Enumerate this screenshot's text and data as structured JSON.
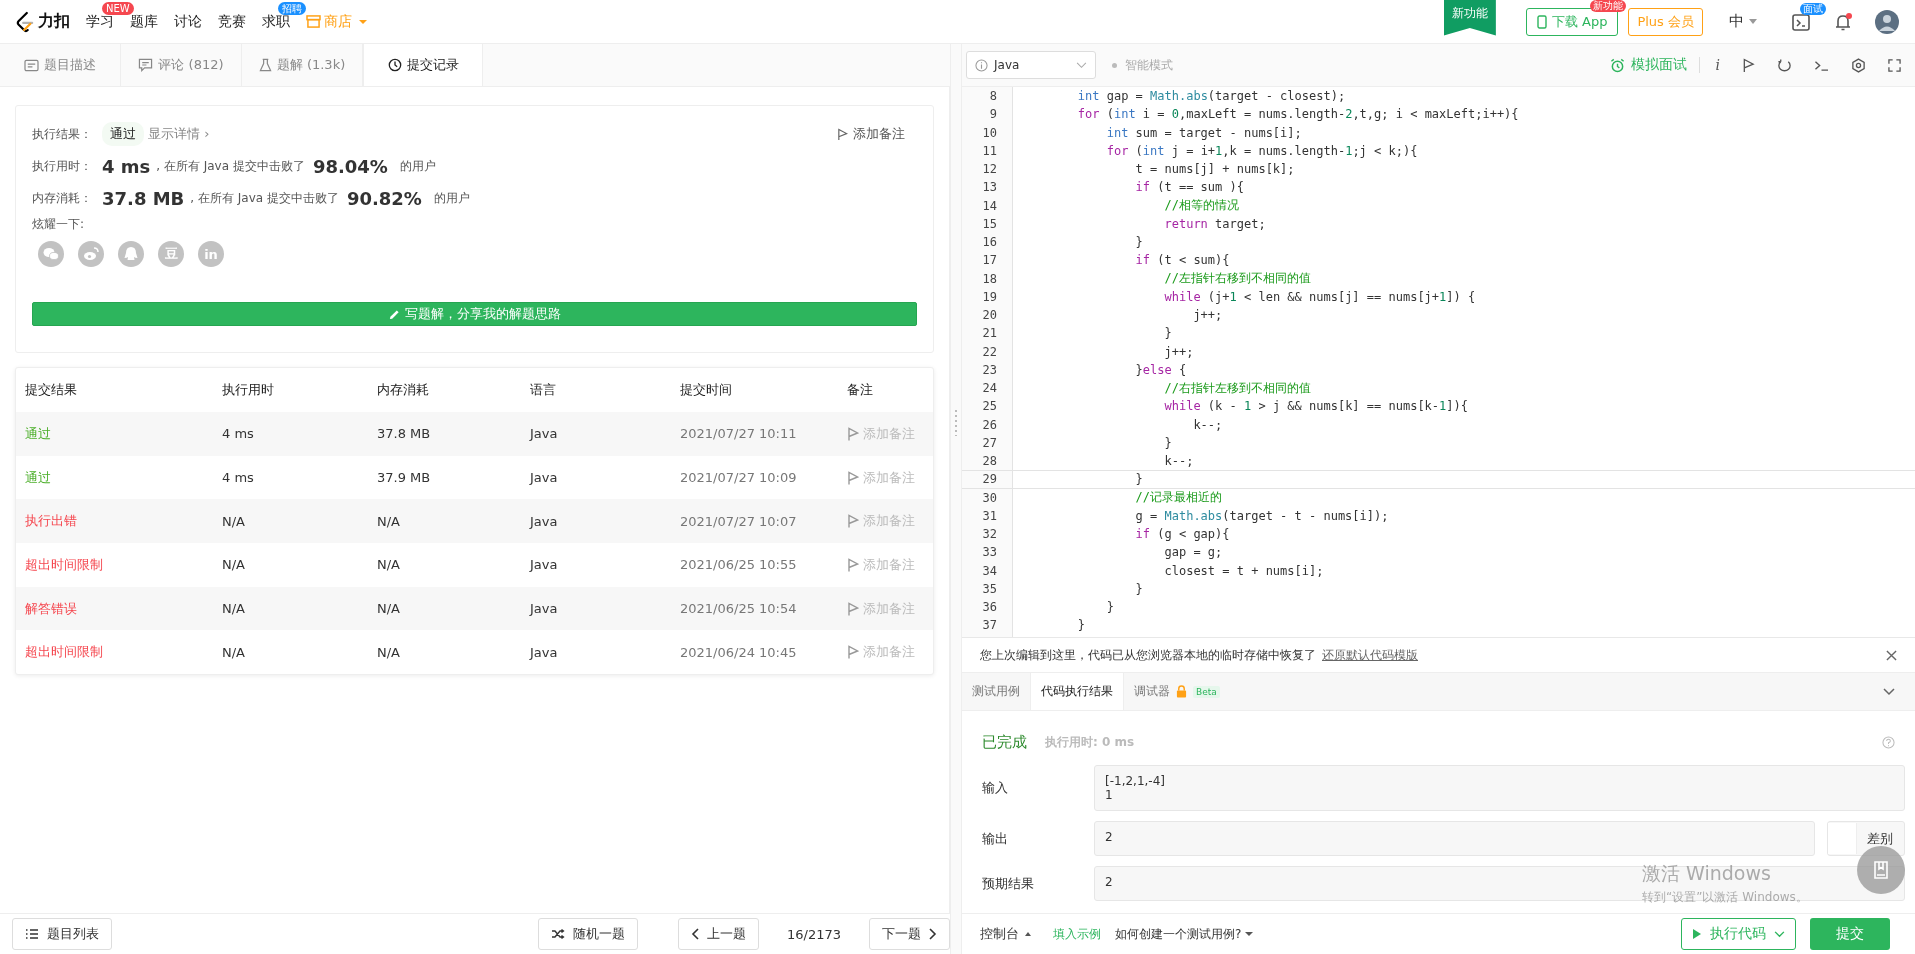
{
  "nav": {
    "logo_text": "力扣",
    "items": [
      {
        "label": "学习",
        "kind": "badge-red",
        "badge": "NEW"
      },
      {
        "label": "题库",
        "kind": "plain"
      },
      {
        "label": "讨论",
        "kind": "plain"
      },
      {
        "label": "竞赛",
        "kind": "plain"
      },
      {
        "label": "求职",
        "kind": "badge-blue",
        "badge": "招聘"
      },
      {
        "label": "商店",
        "kind": "store"
      }
    ],
    "feature_ribbon": "新功能",
    "download": {
      "label": "下载 App",
      "badge": "新功能"
    },
    "plus": "Plus 会员",
    "lang": "中",
    "interview_badge": "面试",
    "unread": true
  },
  "left_tabs": [
    {
      "label": "题目描述",
      "selected": false
    },
    {
      "label": "评论 (812)",
      "selected": false
    },
    {
      "label": "题解 (1.3k)",
      "selected": false
    },
    {
      "label": "提交记录",
      "selected": true
    }
  ],
  "result": {
    "label": "执行结果：",
    "status": "通过",
    "details": "显示详情 ›",
    "add_note": "添加备注",
    "stats": [
      {
        "label": "执行用时：",
        "value": "4 ms",
        "text": ", 在所有 Java 提交中击败了",
        "percent": "98.04%",
        "suffix": "的用户"
      },
      {
        "label": "内存消耗：",
        "value": "37.8 MB",
        "text": ", 在所有 Java 提交中击败了",
        "percent": "90.82%",
        "suffix": "的用户"
      }
    ],
    "share_label": "炫耀一下:",
    "share": [
      {
        "kind": "wechat"
      },
      {
        "kind": "weibo"
      },
      {
        "kind": "qq"
      },
      {
        "kind": "glyph",
        "text": "豆"
      },
      {
        "kind": "glyph",
        "text": "in"
      }
    ],
    "write_button": "写题解，分享我的解题思路"
  },
  "table": {
    "columns": [
      "提交结果",
      "执行用时",
      "内存消耗",
      "语言",
      "提交时间",
      "备注"
    ],
    "rows": [
      {
        "status": "通过",
        "kind": "pass",
        "time": "4 ms",
        "memory": "37.8 MB",
        "lang": "Java",
        "submitted": "2021/07/27 10:11",
        "note": "添加备注"
      },
      {
        "status": "通过",
        "kind": "pass",
        "time": "4 ms",
        "memory": "37.9 MB",
        "lang": "Java",
        "submitted": "2021/07/27 10:09",
        "note": "添加备注"
      },
      {
        "status": "执行出错",
        "kind": "fail",
        "time": "N/A",
        "memory": "N/A",
        "lang": "Java",
        "submitted": "2021/07/27 10:07",
        "note": "添加备注"
      },
      {
        "status": "超出时间限制",
        "kind": "fail",
        "time": "N/A",
        "memory": "N/A",
        "lang": "Java",
        "submitted": "2021/06/25 10:55",
        "note": "添加备注"
      },
      {
        "status": "解答错误",
        "kind": "fail",
        "time": "N/A",
        "memory": "N/A",
        "lang": "Java",
        "submitted": "2021/06/25 10:54",
        "note": "添加备注"
      },
      {
        "status": "超出时间限制",
        "kind": "fail",
        "time": "N/A",
        "memory": "N/A",
        "lang": "Java",
        "submitted": "2021/06/24 10:45",
        "note": "添加备注"
      }
    ]
  },
  "bottom_left": {
    "list_button": "题目列表",
    "random": "随机一题",
    "prev": "上一题",
    "page": "16/2173",
    "next": "下一题"
  },
  "editor": {
    "language": "Java",
    "smart_mode": "智能模式",
    "mock_interview": "模拟面试",
    "info_glyph": "i",
    "lines": [
      {
        "num": "8",
        "current": false,
        "segs": [
          {
            "text": "        int",
            "kind": "type"
          },
          {
            "text": " gap = "
          },
          {
            "text": "Math.abs",
            "kind": "call"
          },
          {
            "text": "(target - closest);"
          }
        ]
      },
      {
        "num": "9",
        "current": false,
        "segs": [
          {
            "text": "        for",
            "kind": "keyword"
          },
          {
            "text": " ("
          },
          {
            "text": "int",
            "kind": "type"
          },
          {
            "text": " i = "
          },
          {
            "text": "0",
            "kind": "number"
          },
          {
            "text": ",maxLeft = nums.length-"
          },
          {
            "text": "2",
            "kind": "number"
          },
          {
            "text": ",t,g; i < maxLeft;i++){"
          }
        ]
      },
      {
        "num": "10",
        "current": false,
        "segs": [
          {
            "text": "            int",
            "kind": "type"
          },
          {
            "text": " sum = target - nums[i];"
          }
        ]
      },
      {
        "num": "11",
        "current": false,
        "segs": [
          {
            "text": "            for",
            "kind": "keyword"
          },
          {
            "text": " ("
          },
          {
            "text": "int",
            "kind": "type"
          },
          {
            "text": " j = i+"
          },
          {
            "text": "1",
            "kind": "number"
          },
          {
            "text": ",k = nums.length-"
          },
          {
            "text": "1",
            "kind": "number"
          },
          {
            "text": ";j < k;){"
          }
        ]
      },
      {
        "num": "12",
        "current": false,
        "segs": [
          {
            "text": "                t = nums[j] + nums[k];"
          }
        ]
      },
      {
        "num": "13",
        "current": false,
        "segs": [
          {
            "text": "                if",
            "kind": "keyword"
          },
          {
            "text": " (t == sum ){"
          }
        ]
      },
      {
        "num": "14",
        "current": false,
        "segs": [
          {
            "text": "                    //相等的情况",
            "kind": "comment"
          }
        ]
      },
      {
        "num": "15",
        "current": false,
        "segs": [
          {
            "text": "                    return",
            "kind": "keyword"
          },
          {
            "text": " target;"
          }
        ]
      },
      {
        "num": "16",
        "current": false,
        "segs": [
          {
            "text": "                }"
          }
        ]
      },
      {
        "num": "17",
        "current": false,
        "segs": [
          {
            "text": "                if",
            "kind": "keyword"
          },
          {
            "text": " (t < sum){"
          }
        ]
      },
      {
        "num": "18",
        "current": false,
        "segs": [
          {
            "text": "                    //左指针右移到不相同的值",
            "kind": "comment"
          }
        ]
      },
      {
        "num": "19",
        "current": false,
        "segs": [
          {
            "text": "                    while",
            "kind": "keyword"
          },
          {
            "text": " (j+"
          },
          {
            "text": "1",
            "kind": "number"
          },
          {
            "text": " < len && nums[j] == nums[j+"
          },
          {
            "text": "1",
            "kind": "number"
          },
          {
            "text": "]) {"
          }
        ]
      },
      {
        "num": "20",
        "current": false,
        "segs": [
          {
            "text": "                        j++;"
          }
        ]
      },
      {
        "num": "21",
        "current": false,
        "segs": [
          {
            "text": "                    }"
          }
        ]
      },
      {
        "num": "22",
        "current": false,
        "segs": [
          {
            "text": "                    j++;"
          }
        ]
      },
      {
        "num": "23",
        "current": false,
        "segs": [
          {
            "text": "                }"
          },
          {
            "text": "else",
            "kind": "keyword"
          },
          {
            "text": " {"
          }
        ]
      },
      {
        "num": "24",
        "current": false,
        "segs": [
          {
            "text": "                    //右指针左移到不相同的值",
            "kind": "comment"
          }
        ]
      },
      {
        "num": "25",
        "current": false,
        "segs": [
          {
            "text": "                    while",
            "kind": "keyword"
          },
          {
            "text": " (k - "
          },
          {
            "text": "1",
            "kind": "number"
          },
          {
            "text": " > j && nums[k] == nums[k-"
          },
          {
            "text": "1",
            "kind": "number"
          },
          {
            "text": "]){"
          }
        ]
      },
      {
        "num": "26",
        "current": false,
        "segs": [
          {
            "text": "                        k--;"
          }
        ]
      },
      {
        "num": "27",
        "current": false,
        "segs": [
          {
            "text": "                    }"
          }
        ]
      },
      {
        "num": "28",
        "current": false,
        "segs": [
          {
            "text": "                    k--;"
          }
        ]
      },
      {
        "num": "29",
        "current": true,
        "segs": [
          {
            "text": "                }"
          }
        ]
      },
      {
        "num": "30",
        "current": false,
        "segs": [
          {
            "text": "                //记录最相近的",
            "kind": "comment"
          }
        ]
      },
      {
        "num": "31",
        "current": false,
        "segs": [
          {
            "text": "                g = "
          },
          {
            "text": "Math.abs",
            "kind": "call"
          },
          {
            "text": "(target - t - nums[i]);"
          }
        ]
      },
      {
        "num": "32",
        "current": false,
        "segs": [
          {
            "text": "                if",
            "kind": "keyword"
          },
          {
            "text": " (g < gap){"
          }
        ]
      },
      {
        "num": "33",
        "current": false,
        "segs": [
          {
            "text": "                    gap = g;"
          }
        ]
      },
      {
        "num": "34",
        "current": false,
        "segs": [
          {
            "text": "                    closest = t + nums[i];"
          }
        ]
      },
      {
        "num": "35",
        "current": false,
        "segs": [
          {
            "text": "                }"
          }
        ]
      },
      {
        "num": "36",
        "current": false,
        "segs": [
          {
            "text": "            }"
          }
        ]
      },
      {
        "num": "37",
        "current": false,
        "segs": [
          {
            "text": "        }"
          }
        ]
      }
    ]
  },
  "notice": {
    "text": "您上次编辑到这里，代码已从您浏览器本地的临时存储中恢复了",
    "link": "还原默认代码模版"
  },
  "console_tabs": [
    {
      "label": "测试用例",
      "selected": false
    },
    {
      "label": "代码执行结果",
      "selected": true
    },
    {
      "label": "调试器",
      "selected": false,
      "locked": true,
      "badge": "Beta"
    }
  ],
  "run_result": {
    "status": "已完成",
    "time": "执行用时: 0 ms",
    "fields": [
      {
        "label": "输入",
        "lines": [
          "[-1,2,1,-4]",
          "1"
        ]
      },
      {
        "label": "输出",
        "lines": [
          "2"
        ],
        "diff": "差别"
      },
      {
        "label": "预期结果",
        "lines": [
          "2"
        ]
      }
    ]
  },
  "bottom_right": {
    "console": "控制台",
    "fill_example": "填入示例",
    "howto": "如何创建一个测试用例?",
    "run": "执行代码",
    "submit": "提交"
  },
  "os_overlay": {
    "title": "激活 Windows",
    "subtitle": "转到“设置”以激活 Windows。"
  }
}
